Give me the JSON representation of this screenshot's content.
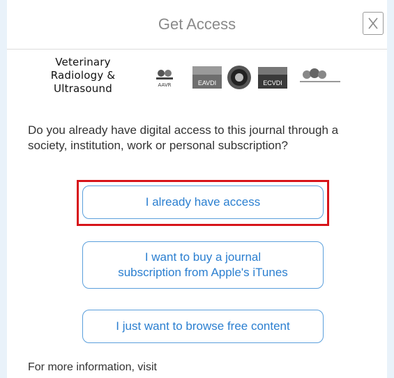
{
  "dialog": {
    "title": "Get Access",
    "close_label": "X"
  },
  "journal": {
    "name_line1": "Veterinary",
    "name_line2": "Radiology &",
    "name_line3": "Ultrasound"
  },
  "society_logos": {
    "logo1": "AAVR",
    "logo2": "EAVDI",
    "logo3": "ECVDI"
  },
  "question": "Do you already have digital access to this journal through a society, institution, work or personal subscription?",
  "buttons": {
    "have_access": "I already have access",
    "buy_line1": "I want to buy a journal",
    "buy_line2": "subscription from Apple's iTunes",
    "browse_free": "I just want to browse free content"
  },
  "footer": {
    "info_text": "For more information, visit"
  },
  "colors": {
    "accent": "#2b7fd0",
    "highlight": "#d7141a",
    "background": "#e9f2fa"
  }
}
